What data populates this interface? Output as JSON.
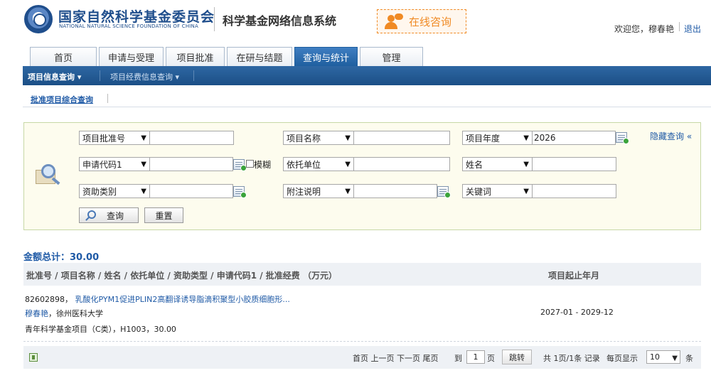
{
  "header": {
    "org_name_cn": "国家自然科学基金委员会",
    "org_name_en": "NATIONAL NATURAL SCIENCE FOUNDATION OF CHINA",
    "system_name": "科学基金网络信息系统",
    "consult_label": "在线咨询",
    "welcome_text": "欢迎您，穆春艳",
    "logout_label": "退出"
  },
  "tabs": [
    {
      "label": "首页",
      "active": false
    },
    {
      "label": "申请与受理",
      "active": false
    },
    {
      "label": "项目批准",
      "active": false
    },
    {
      "label": "在研与结题",
      "active": false
    },
    {
      "label": "查询与统计",
      "active": true
    },
    {
      "label": "管理",
      "active": false
    }
  ],
  "submenu": {
    "items": [
      {
        "label": "项目信息查询 ▾",
        "active": true
      },
      {
        "label": "项目经费信息查询 ▾",
        "active": false
      }
    ]
  },
  "breadcrumb": {
    "label": "批准项目综合查询"
  },
  "search": {
    "row1": {
      "field1_select": "项目批准号",
      "field1_value": "",
      "field2_select": "项目名称",
      "field2_value": "",
      "field3_select": "项目年度",
      "field3_value": "2026"
    },
    "row2": {
      "field1_select": "申请代码1",
      "field1_value": "",
      "fuzzy_label": "模糊",
      "field2_select": "依托单位",
      "field2_value": "",
      "field3_select": "姓名",
      "field3_value": ""
    },
    "row3": {
      "field1_select": "资助类别",
      "field1_value": "",
      "field2_select": "附注说明",
      "field2_value": "",
      "field3_select": "关键词",
      "field3_value": ""
    },
    "hide_label": "隐藏查询 «",
    "query_button": "查询",
    "reset_button": "重置"
  },
  "results": {
    "total_label": "金额总计：30.00",
    "header_left": "批准号 / 项目名称 / 姓名 / 依托单位 / 资助类型 / 申请代码1 / 批准经费 （万元）",
    "header_right": "项目起止年月",
    "rows": [
      {
        "approval_no": "82602898，",
        "project_name": "乳酸化PYM1促进PLIN2高翻译诱导脂滴积聚型小胶质细胞形...",
        "person": "穆春艳",
        "institution": "，徐州医科大学",
        "detail": "青年科学基金项目（C类），H1003，30.00",
        "period": "2027-01 - 2029-12"
      }
    ]
  },
  "pager": {
    "nav_text": "首页 上一页 下一页 尾页",
    "goto_prefix": "到",
    "page_value": "1",
    "page_suffix": "页",
    "jump_button": "跳转",
    "summary": "共 1页/1条 记录",
    "per_page_label": "每页显示",
    "per_page_value": "10",
    "per_page_suffix": "条"
  }
}
